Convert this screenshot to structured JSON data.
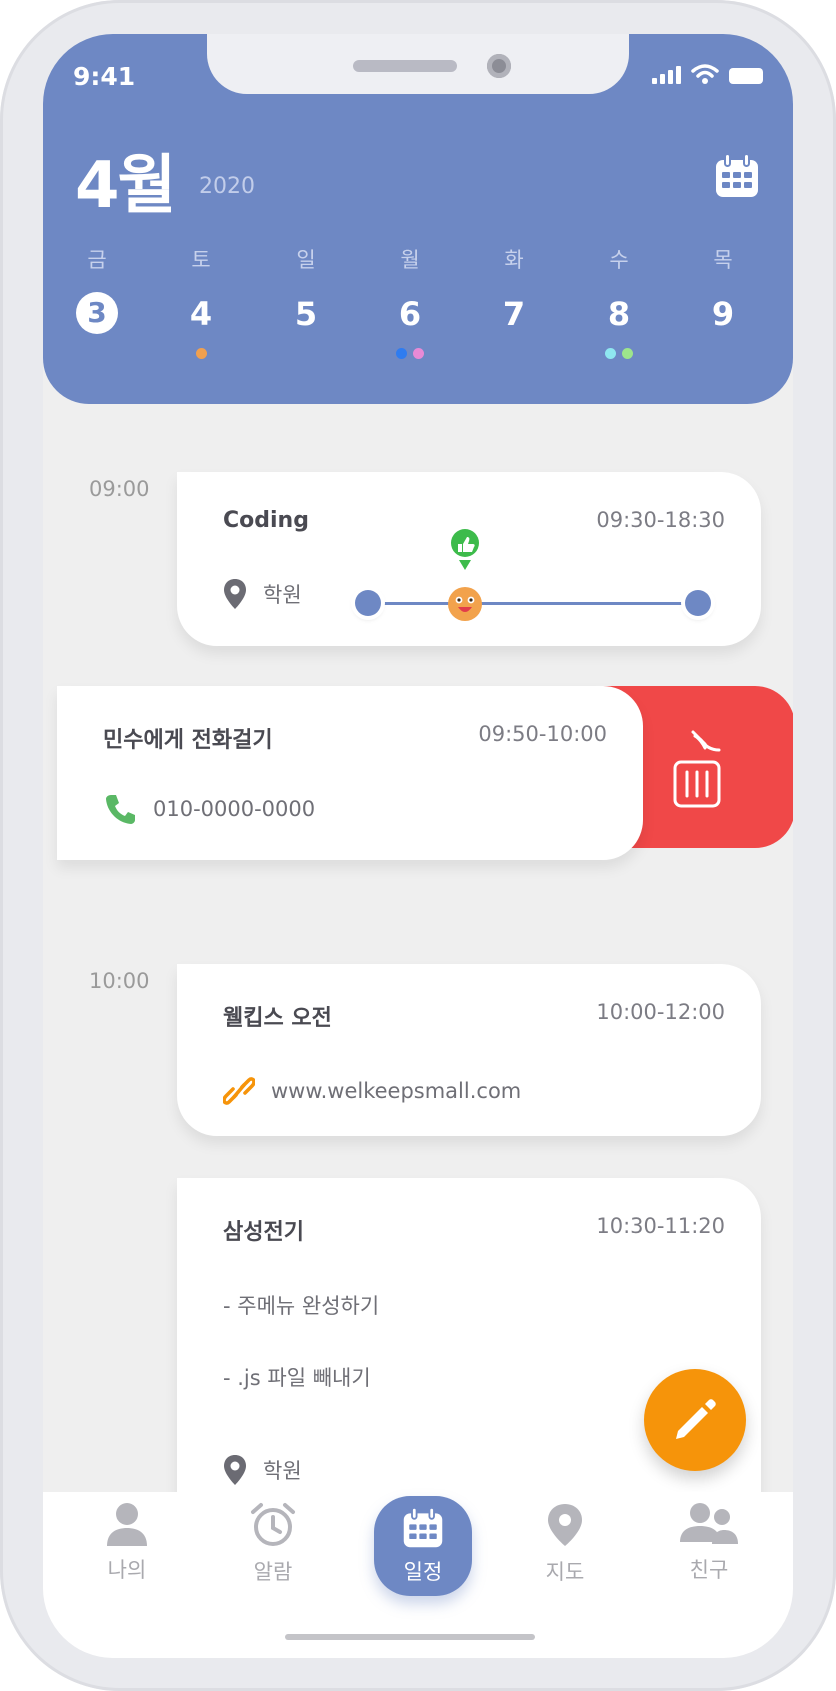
{
  "status": {
    "time": "9:41"
  },
  "header": {
    "month": "4월",
    "year": "2020",
    "calendar_icon": "calendar-icon",
    "days": [
      {
        "name": "금",
        "num": "3",
        "selected": true,
        "dots": []
      },
      {
        "name": "토",
        "num": "4",
        "selected": false,
        "dots": [
          "#f0a050"
        ]
      },
      {
        "name": "일",
        "num": "5",
        "selected": false,
        "dots": []
      },
      {
        "name": "월",
        "num": "6",
        "selected": false,
        "dots": [
          "#2f7cf0",
          "#e88ad6"
        ]
      },
      {
        "name": "화",
        "num": "7",
        "selected": false,
        "dots": []
      },
      {
        "name": "수",
        "num": "8",
        "selected": false,
        "dots": [
          "#8fe7f0",
          "#9de58c"
        ]
      },
      {
        "name": "목",
        "num": "9",
        "selected": false,
        "dots": []
      }
    ]
  },
  "timeline": {
    "labels": [
      "09:00",
      "10:00"
    ],
    "events": [
      {
        "title": "Coding",
        "range": "09:30-18:30",
        "info": "학원",
        "icon": "location-pin-icon",
        "progress_marker": "thumbs-up-icon"
      },
      {
        "title": "민수에게 전화걸기",
        "range": "09:50-10:00",
        "info": "010-0000-0000",
        "icon": "phone-icon",
        "action": "trash-icon"
      },
      {
        "title": "웰킵스 오전",
        "range": "10:00-12:00",
        "info": "www.welkeepsmall.com",
        "icon": "link-icon"
      },
      {
        "title": "삼성전기",
        "range": "10:30-11:20",
        "notes": [
          "- 주메뉴 완성하기",
          "- .js 파일 빼내기"
        ],
        "info": "학원",
        "icon": "location-pin-icon"
      }
    ]
  },
  "fab": {
    "icon": "pencil-icon"
  },
  "tabbar": {
    "tabs": [
      {
        "label": "나의",
        "icon": "person-icon",
        "active": false
      },
      {
        "label": "알람",
        "icon": "alarm-clock-icon",
        "active": false
      },
      {
        "label": "일정",
        "icon": "calendar-icon",
        "active": true
      },
      {
        "label": "지도",
        "icon": "map-pin-icon",
        "active": false
      },
      {
        "label": "친구",
        "icon": "friends-icon",
        "active": false
      }
    ]
  },
  "colors": {
    "accent": "#6e88c4",
    "delete": "#f04848",
    "fab": "#f6940a"
  }
}
